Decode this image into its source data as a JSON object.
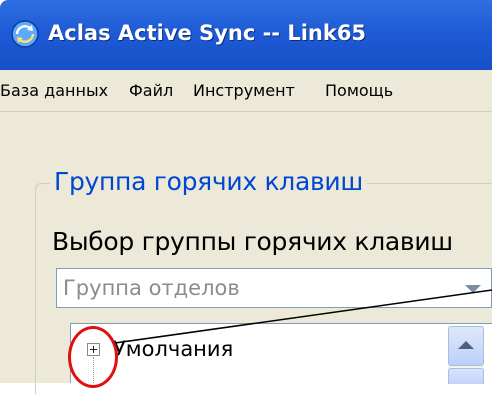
{
  "window": {
    "title": "Aclas Active Sync -- Link65",
    "icon": "app-sync-icon"
  },
  "menubar": {
    "items": [
      {
        "label": "База данных"
      },
      {
        "label": "Файл"
      },
      {
        "label": "Инструмент"
      },
      {
        "label": "Помощь"
      }
    ]
  },
  "hotkey_group": {
    "legend": "Группа горячих клавиш",
    "select_label": "Выбор группы горячих клавиш",
    "dropdown_value": "Группа отделов"
  },
  "tree": {
    "items": [
      {
        "label": "Умолчания",
        "expander": "plus-box-icon"
      }
    ]
  },
  "annotation": {
    "color": "#e01010"
  },
  "colors": {
    "titlebar": "#1e5bd6",
    "legend_text": "#0046d5",
    "surface": "#ece9d8"
  }
}
